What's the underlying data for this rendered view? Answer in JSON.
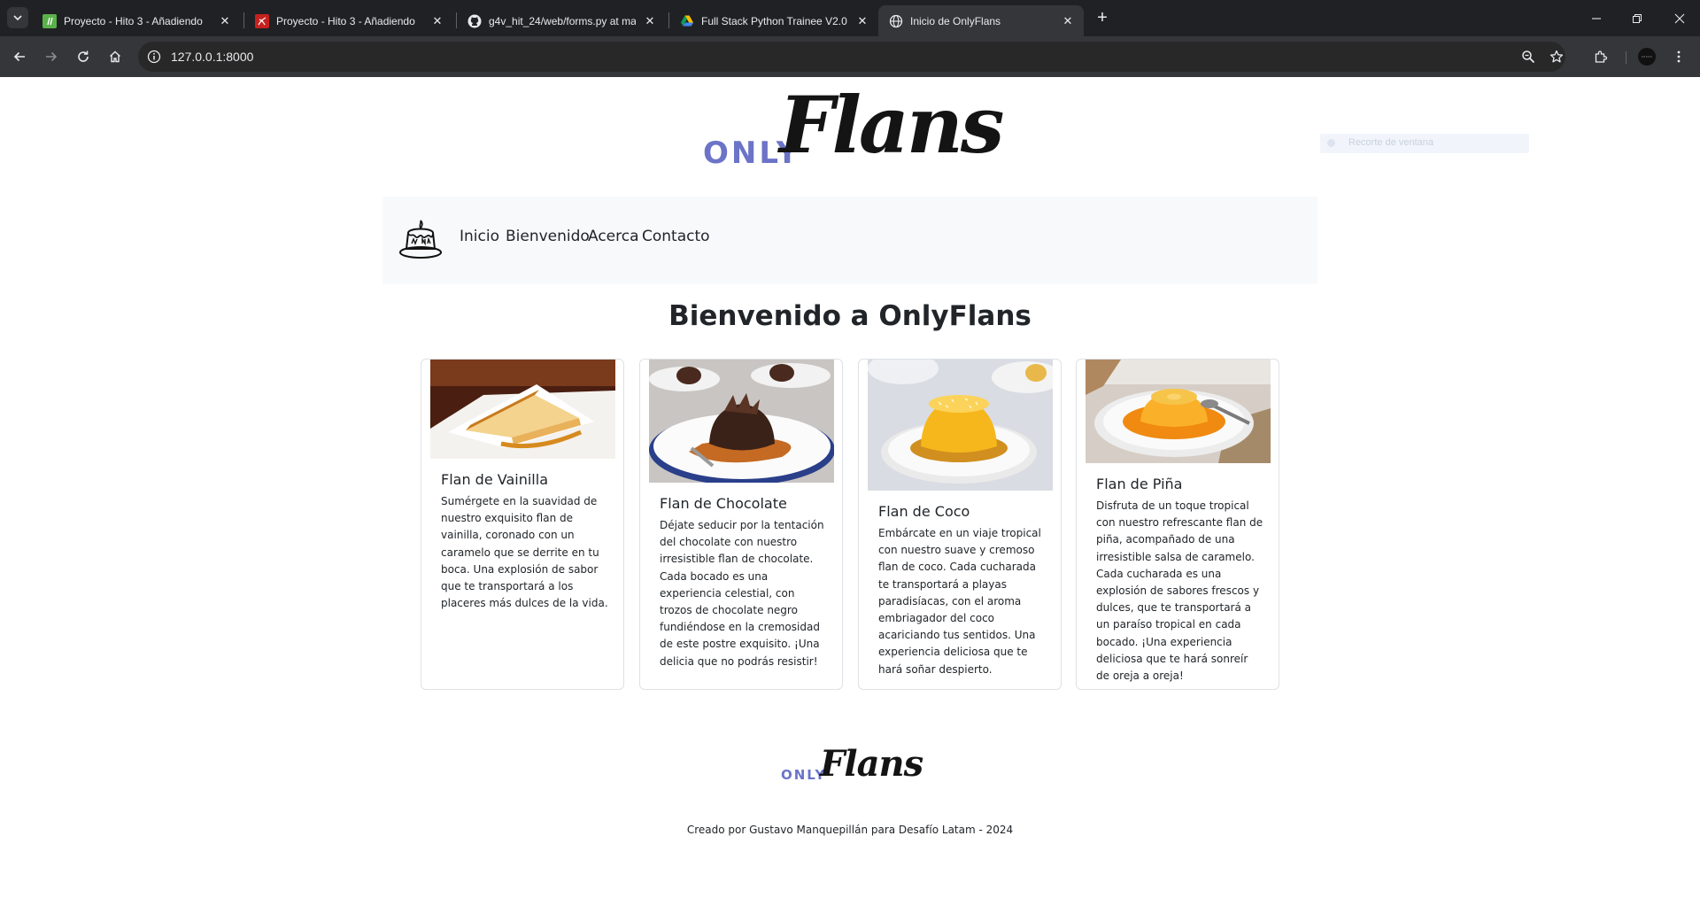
{
  "browser": {
    "tabs": [
      {
        "title": "Proyecto - Hito 3 - Añadiendo",
        "favicon": "green-app-icon",
        "active": false
      },
      {
        "title": "Proyecto - Hito 3 - Añadiendo",
        "favicon": "pdf-icon",
        "active": false
      },
      {
        "title": "g4v_hit_24/web/forms.py at ma",
        "favicon": "github-icon",
        "active": false
      },
      {
        "title": "Full Stack Python Trainee V2.0",
        "favicon": "google-drive-icon",
        "active": false
      },
      {
        "title": "Inicio de OnlyFlans",
        "favicon": "globe-icon",
        "active": true
      }
    ],
    "url": "127.0.0.1:8000",
    "colors": {
      "tabbar": "#202124",
      "toolbar": "#35363a",
      "omnibox": "#282828"
    }
  },
  "page": {
    "logo": {
      "only": "ONLY",
      "flans": "Flans"
    },
    "snip_overlay": "Recorte de ventana",
    "nav": {
      "links": [
        "Inicio",
        "Bienvenido",
        "Acerca",
        "Contacto"
      ]
    },
    "heading": "Bienvenido a OnlyFlans",
    "cards": [
      {
        "title": "Flan de Vainilla",
        "description": "Sumérgete en la suavidad de nuestro exquisito flan de vainilla, coronado con un caramelo que se derrite en tu boca. Una explosión de sabor que te transportará a los placeres más dulces de la vida."
      },
      {
        "title": "Flan de Chocolate",
        "description": "Déjate seducir por la tentación del chocolate con nuestro irresistible flan de chocolate. Cada bocado es una experiencia celestial, con trozos de chocolate negro fundiéndose en la cremosidad de este postre exquisito. ¡Una delicia que no podrás resistir!"
      },
      {
        "title": "Flan de Coco",
        "description": "Embárcate en un viaje tropical con nuestro suave y cremoso flan de coco. Cada cucharada te transportará a playas paradisíacas, con el aroma embriagador del coco acariciando tus sentidos. Una experiencia deliciosa que te hará soñar despierto."
      },
      {
        "title": "Flan de Piña",
        "description": "Disfruta de un toque tropical con nuestro refrescante flan de piña, acompañado de una irresistible salsa de caramelo. Cada cucharada es una explosión de sabores frescos y dulces, que te transportará a un paraíso tropical en cada bocado. ¡Una experiencia deliciosa que te hará sonreír de oreja a oreja!"
      }
    ],
    "footer": {
      "logo": {
        "only": "ONLY",
        "flans": "Flans"
      },
      "credit": "Creado por Gustavo Manquepillán para Desafío Latam - 2024"
    },
    "colors": {
      "logo_only": "#6b74c7",
      "navbar_bg": "#f8f9fa",
      "text": "#212529"
    }
  }
}
